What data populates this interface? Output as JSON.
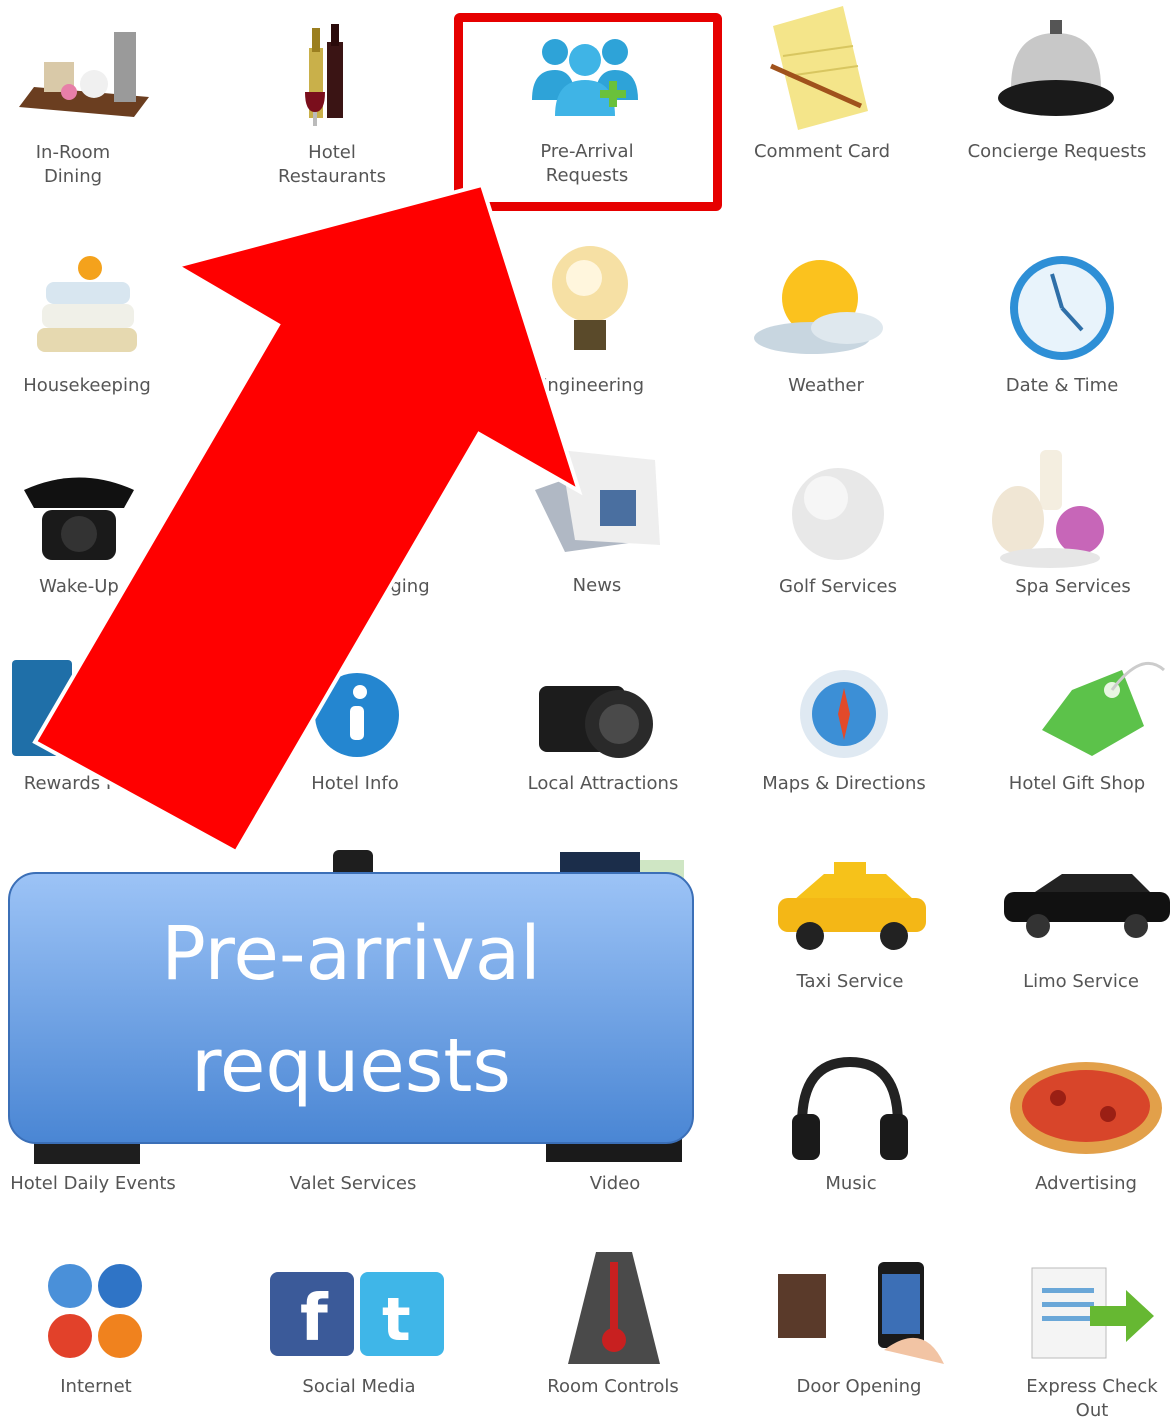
{
  "tiles": [
    {
      "label": "In-Room\nDining"
    },
    {
      "label": "Hotel\nRestaurants"
    },
    {
      "label": "Pre-Arrival\nRequests"
    },
    {
      "label": "Comment Card"
    },
    {
      "label": "Concierge Requests"
    },
    {
      "label": "Housekeeping"
    },
    {
      "label": "Engineering"
    },
    {
      "label": "Weather"
    },
    {
      "label": "Date & Time"
    },
    {
      "label": "Wake-Up"
    },
    {
      "label": "ging"
    },
    {
      "label": "News"
    },
    {
      "label": "Golf Services"
    },
    {
      "label": "Spa Services"
    },
    {
      "label": "Rewards F"
    },
    {
      "label": "Hotel Info"
    },
    {
      "label": "Local Attractions"
    },
    {
      "label": "Maps & Directions"
    },
    {
      "label": "Hotel Gift Shop"
    },
    {
      "label": "Taxi Service"
    },
    {
      "label": "Limo Service"
    },
    {
      "label": "Hotel Daily Events"
    },
    {
      "label": "Valet Services"
    },
    {
      "label": "Video"
    },
    {
      "label": "Music"
    },
    {
      "label": "Advertising"
    },
    {
      "label": "Internet"
    },
    {
      "label": "Social Media"
    },
    {
      "label": "Room Controls"
    },
    {
      "label": "Door Opening"
    },
    {
      "label": "Express Check\nOut"
    }
  ],
  "callout": {
    "line1": "Pre-arrival",
    "line2": "requests"
  },
  "colors": {
    "highlight": "#e60000",
    "callout": "#5b93dd"
  }
}
